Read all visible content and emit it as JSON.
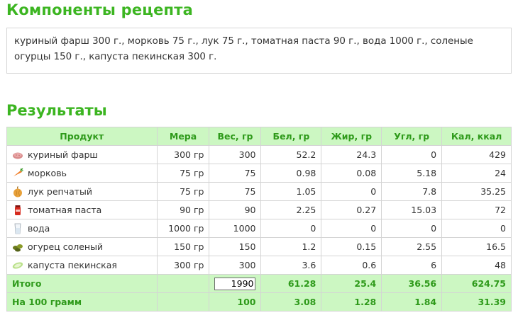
{
  "headings": {
    "components": "Компоненты рецепта",
    "results": "Результаты"
  },
  "components_text": "куриный фарш 300 г., морковь 75 г., лук 75 г., томатная паста 90 г., вода 1000 г., соленые огурцы 150 г., капуста пекинская 300 г.",
  "table": {
    "headers": [
      "Продукт",
      "Мера",
      "Вес, гр",
      "Бел, гр",
      "Жир, гр",
      "Угл, гр",
      "Кал, ккал"
    ],
    "rows": [
      {
        "icon": "minced-meat-icon",
        "product": "куриный фарш",
        "measure": "300 гр",
        "weight": "300",
        "protein": "52.2",
        "fat": "24.3",
        "carbs": "0",
        "kcal": "429"
      },
      {
        "icon": "carrot-icon",
        "product": "морковь",
        "measure": "75 гр",
        "weight": "75",
        "protein": "0.98",
        "fat": "0.08",
        "carbs": "5.18",
        "kcal": "24"
      },
      {
        "icon": "onion-icon",
        "product": "лук репчатый",
        "measure": "75 гр",
        "weight": "75",
        "protein": "1.05",
        "fat": "0",
        "carbs": "7.8",
        "kcal": "35.25"
      },
      {
        "icon": "tomato-paste-icon",
        "product": "томатная паста",
        "measure": "90 гр",
        "weight": "90",
        "protein": "2.25",
        "fat": "0.27",
        "carbs": "15.03",
        "kcal": "72"
      },
      {
        "icon": "water-glass-icon",
        "product": "вода",
        "measure": "1000 гр",
        "weight": "1000",
        "protein": "0",
        "fat": "0",
        "carbs": "0",
        "kcal": "0"
      },
      {
        "icon": "pickles-icon",
        "product": "огурец соленый",
        "measure": "150 гр",
        "weight": "150",
        "protein": "1.2",
        "fat": "0.15",
        "carbs": "2.55",
        "kcal": "16.5"
      },
      {
        "icon": "chinese-cabbage-icon",
        "product": "капуста пекинская",
        "measure": "300 гр",
        "weight": "300",
        "protein": "3.6",
        "fat": "0.6",
        "carbs": "6",
        "kcal": "48"
      }
    ],
    "total": {
      "label": "Итого",
      "weight_value": "1990",
      "protein": "61.28",
      "fat": "25.4",
      "carbs": "36.56",
      "kcal": "624.75"
    },
    "per100": {
      "label": "На 100 грамм",
      "weight": "100",
      "protein": "3.08",
      "fat": "1.28",
      "carbs": "1.84",
      "kcal": "31.39"
    }
  }
}
